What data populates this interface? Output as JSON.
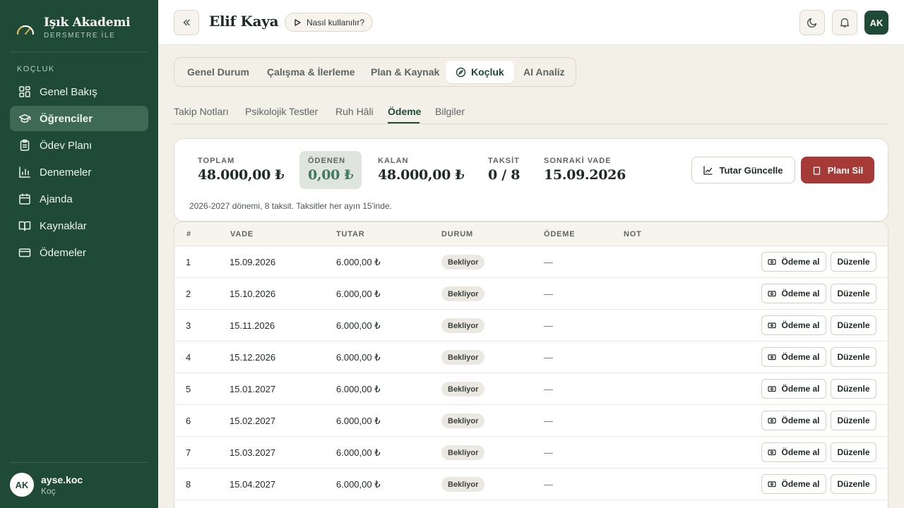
{
  "sidebar": {
    "brand_title": "Işık Akademi",
    "brand_subtitle": "DERSMETRE İLE",
    "section_label": "KOÇLUK",
    "items": [
      {
        "label": "Genel Bakış",
        "icon": "grid-icon"
      },
      {
        "label": "Öğrenciler",
        "icon": "graduation-cap-icon",
        "active": true
      },
      {
        "label": "Ödev Planı",
        "icon": "clipboard-icon"
      },
      {
        "label": "Denemeler",
        "icon": "bar-chart-icon"
      },
      {
        "label": "Ajanda",
        "icon": "calendar-icon"
      },
      {
        "label": "Kaynaklar",
        "icon": "book-icon"
      },
      {
        "label": "Ödemeler",
        "icon": "credit-card-icon"
      }
    ],
    "user": {
      "initials": "AK",
      "name": "ayse.koc",
      "role": "Koç"
    }
  },
  "header": {
    "collapse_icon": "chevrons-left-icon",
    "title": "Elif Kaya",
    "help_label": "Nasıl kullanılır?",
    "user_initials": "AK"
  },
  "top_tabs": [
    {
      "label": "Genel Durum"
    },
    {
      "label": "Çalışma & İlerleme"
    },
    {
      "label": "Plan & Kaynak"
    },
    {
      "label": "Koçluk",
      "active": true
    },
    {
      "label": "AI Analiz"
    }
  ],
  "sub_tabs": [
    {
      "label": "Takip Notları"
    },
    {
      "label": "Psikolojik Testler"
    },
    {
      "label": "Ruh Hâli"
    },
    {
      "label": "Ödeme",
      "active": true
    },
    {
      "label": "Bilgiler"
    }
  ],
  "summary": {
    "stats": [
      {
        "label": "TOPLAM",
        "value": "48.000,00 ₺"
      },
      {
        "label": "ÖDENEN",
        "value": "0,00 ₺"
      },
      {
        "label": "KALAN",
        "value": "48.000,00 ₺"
      },
      {
        "label": "TAKSİT",
        "value": "0 / 8"
      },
      {
        "label": "SONRAKİ VADE",
        "value": "15.09.2026"
      }
    ],
    "note": "2026-2027 dönemi, 8 taksit. Taksitler her ayın 15'inde.",
    "update_button": "Tutar Güncelle",
    "delete_button": "Planı Sil"
  },
  "table": {
    "headers": {
      "num": "#",
      "due": "VADE",
      "amount": "TUTAR",
      "status": "DURUM",
      "payment": "ÖDEME",
      "note": "NOT"
    },
    "pay_label": "Ödeme al",
    "edit_label": "Düzenle",
    "rows": [
      {
        "num": "1",
        "due": "15.09.2026",
        "amount": "6.000,00 ₺",
        "status": "Bekliyor",
        "payment": "—"
      },
      {
        "num": "2",
        "due": "15.10.2026",
        "amount": "6.000,00 ₺",
        "status": "Bekliyor",
        "payment": "—"
      },
      {
        "num": "3",
        "due": "15.11.2026",
        "amount": "6.000,00 ₺",
        "status": "Bekliyor",
        "payment": "—"
      },
      {
        "num": "4",
        "due": "15.12.2026",
        "amount": "6.000,00 ₺",
        "status": "Bekliyor",
        "payment": "—"
      },
      {
        "num": "5",
        "due": "15.01.2027",
        "amount": "6.000,00 ₺",
        "status": "Bekliyor",
        "payment": "—"
      },
      {
        "num": "6",
        "due": "15.02.2027",
        "amount": "6.000,00 ₺",
        "status": "Bekliyor",
        "payment": "—"
      },
      {
        "num": "7",
        "due": "15.03.2027",
        "amount": "6.000,00 ₺",
        "status": "Bekliyor",
        "payment": "—"
      },
      {
        "num": "8",
        "due": "15.04.2027",
        "amount": "6.000,00 ₺",
        "status": "Bekliyor",
        "payment": "—"
      }
    ]
  },
  "colors": {
    "sidebar": "#1e4a37",
    "accent": "#1e4a37",
    "danger": "#a63a37",
    "paid": "#3f7a5c"
  }
}
